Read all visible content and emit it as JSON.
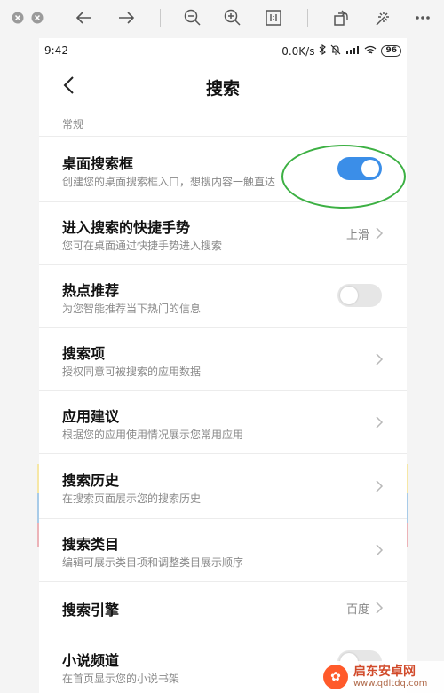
{
  "viewer_toolbar": {
    "icons": [
      "close-icon",
      "minimize-icon",
      "back-arrow-icon",
      "forward-arrow-icon",
      "zoom-out-icon",
      "zoom-in-icon",
      "actual-size-icon",
      "rotate-icon",
      "enhance-icon",
      "more-icon"
    ]
  },
  "status_bar": {
    "time": "9:42",
    "speed": "0.0K/s",
    "battery": "96"
  },
  "header": {
    "title": "搜索"
  },
  "section": {
    "label": "常规"
  },
  "settings": [
    {
      "title": "桌面搜索框",
      "subtitle": "创建您的桌面搜索框入口，想搜内容一触直达",
      "control": "toggle",
      "on": true
    },
    {
      "title": "进入搜索的快捷手势",
      "subtitle": "您可在桌面通过快捷手势进入搜索",
      "control": "chevron",
      "value": "上滑"
    },
    {
      "title": "热点推荐",
      "subtitle": "为您智能推荐当下热门的信息",
      "control": "toggle",
      "on": false
    },
    {
      "title": "搜索项",
      "subtitle": "授权同意可被搜索的应用数据",
      "control": "chevron",
      "value": ""
    },
    {
      "title": "应用建议",
      "subtitle": "根据您的应用使用情况展示您常用应用",
      "control": "chevron",
      "value": ""
    },
    {
      "title": "搜索历史",
      "subtitle": "在搜索页面展示您的搜索历史",
      "control": "chevron",
      "value": ""
    },
    {
      "title": "搜索类目",
      "subtitle": "编辑可展示类目项和调整类目展示顺序",
      "control": "chevron",
      "value": ""
    },
    {
      "title": "搜索引擎",
      "subtitle": "",
      "control": "chevron",
      "value": "百度"
    },
    {
      "title": "小说频道",
      "subtitle": "在首页显示您的小说书架",
      "control": "toggle",
      "on": false
    }
  ],
  "colors": {
    "accent": "#3b8ee8",
    "highlight_ring": "#3cb043",
    "stripe_yellow": "#f6e7a6",
    "stripe_blue": "#a8cbe8",
    "stripe_pink": "#ecb3b8"
  },
  "watermark": {
    "name": "启东安卓网",
    "url": "www.qdltdq.com"
  }
}
